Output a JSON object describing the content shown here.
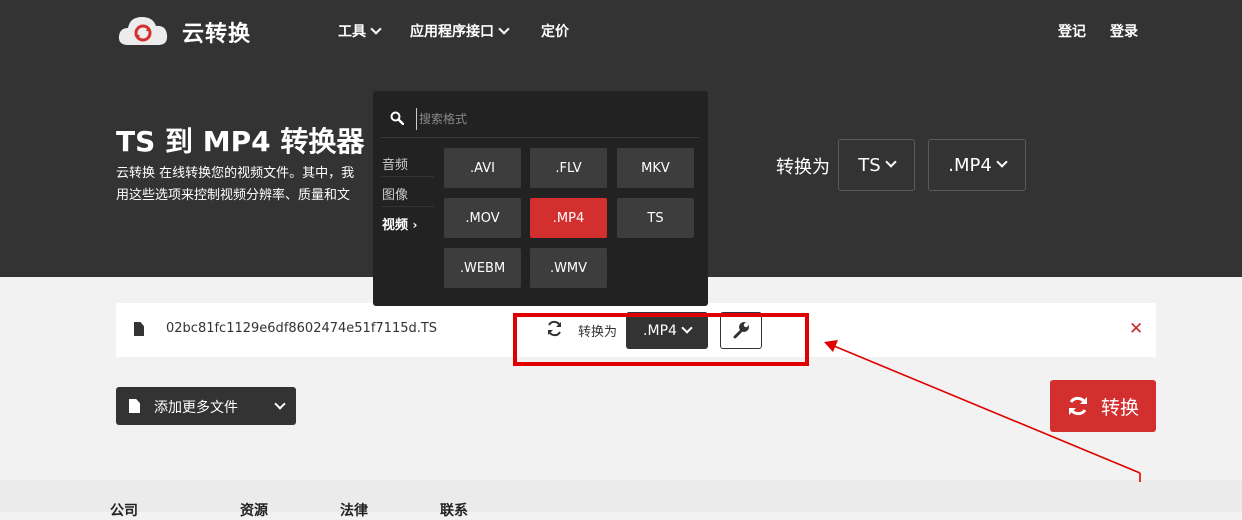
{
  "colors": {
    "accent": "#d32f2f",
    "hero_bg": "#333333",
    "dropdown_bg": "#222222",
    "highlight": "#e00000"
  },
  "header": {
    "brand": "云转换",
    "nav": {
      "tools": "工具",
      "api": "应用程序接口",
      "pricing": "定价"
    },
    "signup": "登记",
    "login": "登录"
  },
  "hero": {
    "title": "TS 到 MP4 转换器",
    "desc_line1": "云转换 在线转换您的视频文件。其中，我",
    "desc_line2": "用这些选项来控制视频分辨率、质量和文",
    "to_label": "转换为",
    "source_format": "TS",
    "target_format": ".MP4"
  },
  "format_dropdown": {
    "search_placeholder": "搜索格式",
    "categories": [
      "音频",
      "图像",
      "视频"
    ],
    "active_category": "视频",
    "formats": [
      ".AVI",
      ".FLV",
      "MKV",
      ".MOV",
      ".MP4",
      "TS",
      ".WEBM",
      ".WMV"
    ],
    "selected_format": ".MP4"
  },
  "file_row": {
    "file_name": "02bc81fc1129e6df8602474e51f7115d.TS",
    "to_label": "转换为",
    "format": ".MP4"
  },
  "actions": {
    "add_more_files": "添加更多文件",
    "convert": "转换"
  },
  "footer": [
    "公司",
    "资源",
    "法律",
    "联系"
  ]
}
